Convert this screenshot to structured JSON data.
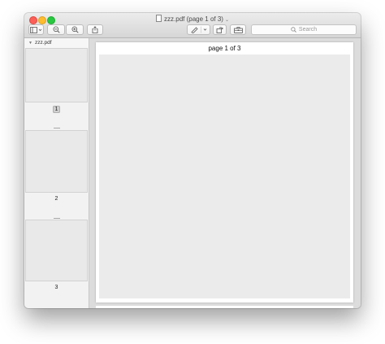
{
  "window": {
    "title": "zzz.pdf (page 1 of 3)"
  },
  "toolbar": {
    "sidebar_toggle_icon": "sidebar-icon",
    "zoom_out_icon": "zoom-out-icon",
    "zoom_in_icon": "zoom-in-icon",
    "share_icon": "share-icon",
    "markup_icon": "pen-icon",
    "rotate_icon": "rotate-icon",
    "toolbox_icon": "toolbox-icon",
    "search": {
      "placeholder": "Search"
    }
  },
  "sidebar": {
    "document_name": "zzz.pdf",
    "thumbnails": [
      {
        "label": "1",
        "selected": true
      },
      {
        "label": "2",
        "selected": false
      },
      {
        "label": "3",
        "selected": false
      }
    ]
  },
  "main": {
    "page_header": "page 1 of 3"
  }
}
